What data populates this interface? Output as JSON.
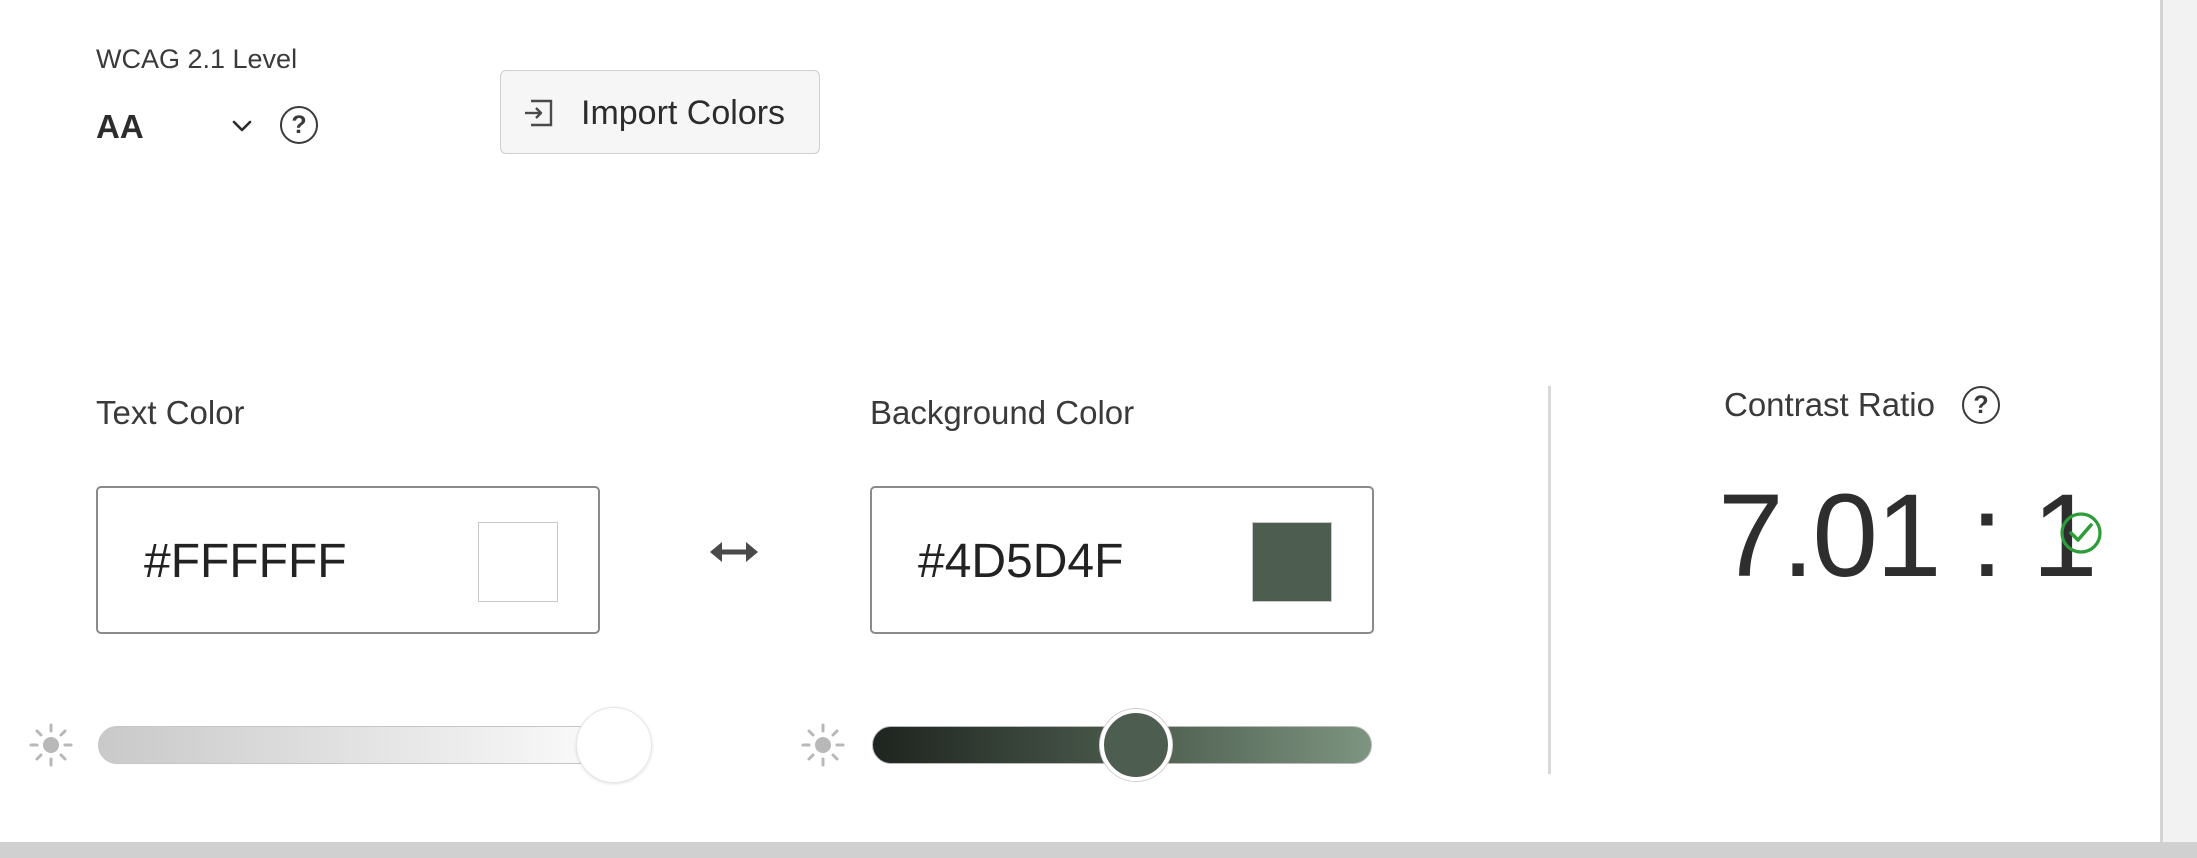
{
  "wcag": {
    "label": "WCAG 2.1 Level",
    "selected": "AA"
  },
  "toolbar": {
    "import_label": "Import Colors"
  },
  "text_color": {
    "label": "Text Color",
    "hex": "#FFFFFF",
    "swatch": "#FFFFFF",
    "brightness": 1.0
  },
  "background_color": {
    "label": "Background Color",
    "hex": "#4D5D4F",
    "swatch": "#4D5D4F",
    "brightness": 0.54
  },
  "contrast": {
    "label": "Contrast Ratio",
    "ratio": "7.01 : 1",
    "status": "pass"
  },
  "icons": {
    "wcag_dropdown": "chevron-down-icon",
    "help": "help-icon",
    "import": "import-icon",
    "swap": "swap-icon",
    "brightness": "sun-icon",
    "pass": "check-circle-icon"
  },
  "colors": {
    "pass_green": "#2d9d3a",
    "text_dark": "#2c2c2c"
  }
}
